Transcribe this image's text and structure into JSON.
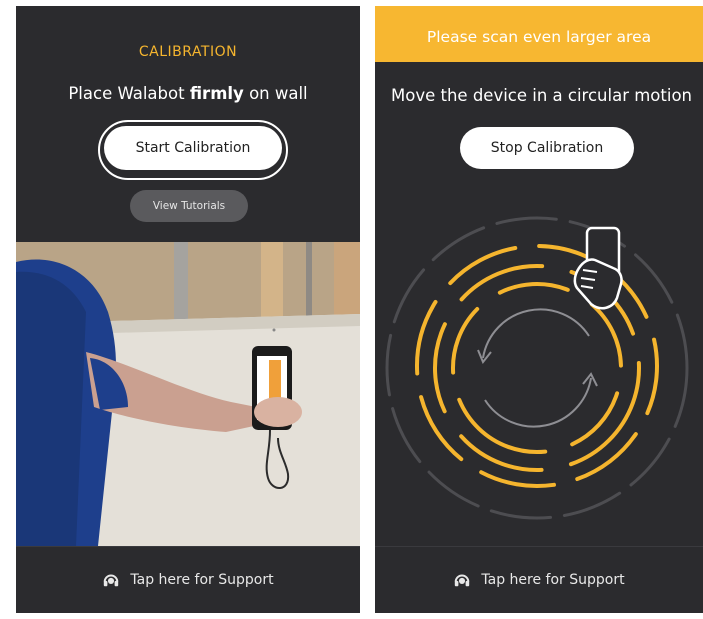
{
  "left": {
    "title": "CALIBRATION",
    "instruction_pre": "Place Walabot",
    "instruction_bold": "firmly",
    "instruction_post": "on wall",
    "start_button": "Start Calibration",
    "tutorials_button": "View Tutorials",
    "support": "Tap here for Support"
  },
  "right": {
    "banner": "Please scan even larger area",
    "instruction": "Move the device in a circular motion",
    "stop_button": "Stop Calibration",
    "support": "Tap here for Support"
  },
  "colors": {
    "background": "#2b2b2e",
    "accent": "#f7b731",
    "button": "#ffffff"
  },
  "icons": [
    "headset-icon",
    "hand-holding-phone-icon",
    "circular-arrows-icon"
  ]
}
